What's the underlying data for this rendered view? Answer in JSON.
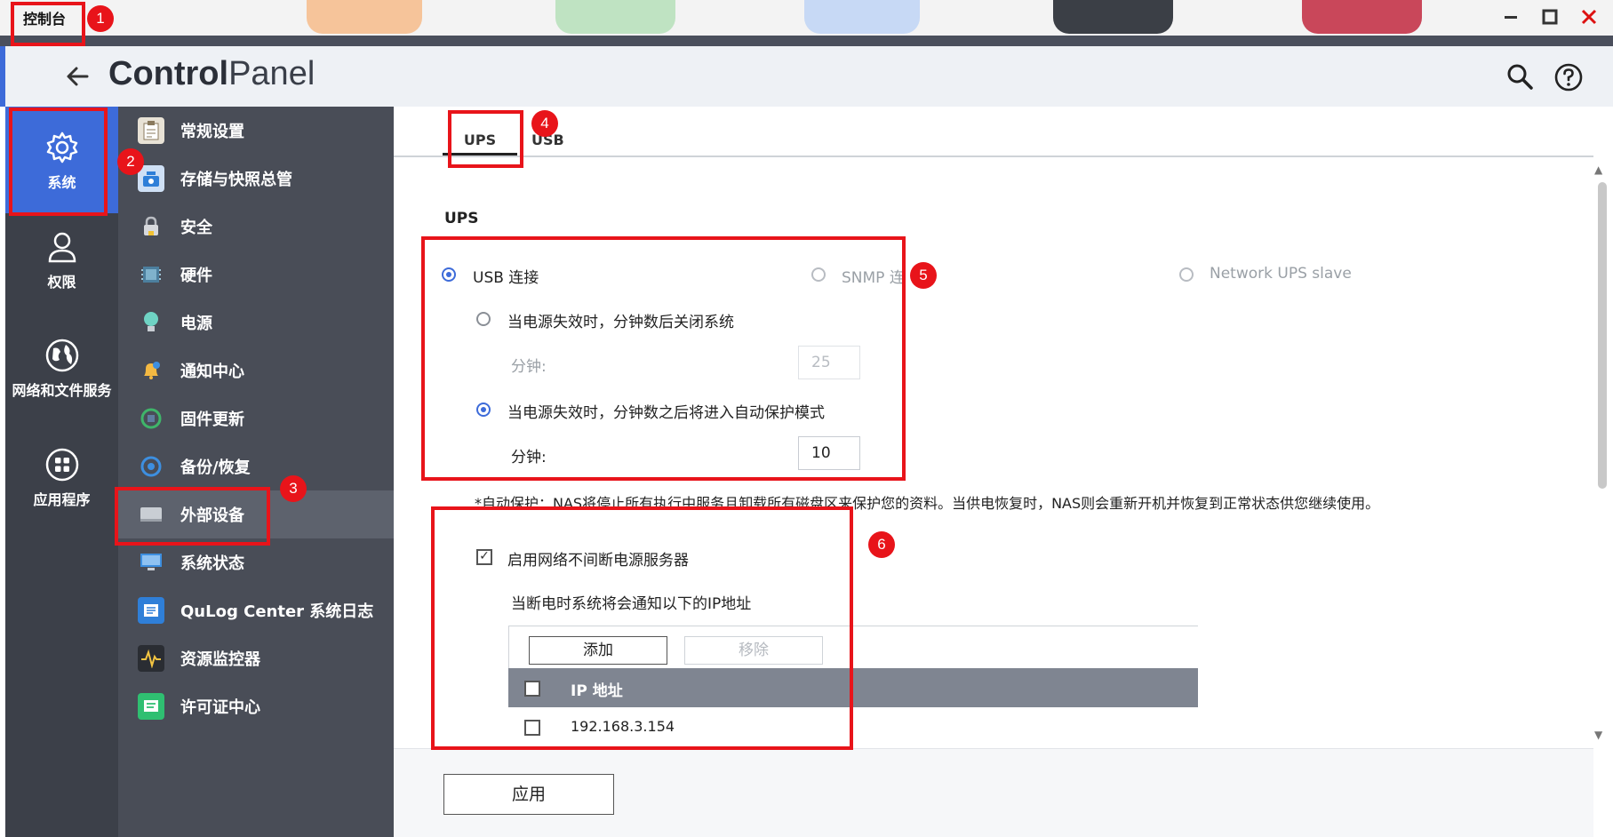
{
  "window": {
    "title": "控制台",
    "controls": [
      "minimize-icon",
      "maximize-icon",
      "close-icon"
    ]
  },
  "header": {
    "brand_bold": "Control",
    "brand_light": "Panel",
    "icons": [
      "back-arrow-icon",
      "search-icon",
      "help-icon"
    ]
  },
  "rail": {
    "items": [
      {
        "label": "系统",
        "icon": "gear-icon"
      },
      {
        "label": "权限",
        "icon": "user-icon"
      },
      {
        "label": "网络和文件服务",
        "icon": "globe-icon"
      },
      {
        "label": "应用程序",
        "icon": "apps-grid-icon"
      }
    ]
  },
  "menu": {
    "items": [
      {
        "label": "常规设置",
        "icon": "general-settings-icon"
      },
      {
        "label": "存储与快照总管",
        "icon": "storage-icon"
      },
      {
        "label": "安全",
        "icon": "lock-icon"
      },
      {
        "label": "硬件",
        "icon": "hardware-icon"
      },
      {
        "label": "电源",
        "icon": "power-bulb-icon"
      },
      {
        "label": "通知中心",
        "icon": "notification-icon"
      },
      {
        "label": "固件更新",
        "icon": "firmware-icon"
      },
      {
        "label": "备份/恢复",
        "icon": "backup-icon"
      },
      {
        "label": "外部设备",
        "icon": "external-device-icon"
      },
      {
        "label": "系统状态",
        "icon": "monitor-icon"
      },
      {
        "label": "QuLog Center 系统日志",
        "icon": "qulog-icon"
      },
      {
        "label": "资源监控器",
        "icon": "resource-monitor-icon"
      },
      {
        "label": "许可证中心",
        "icon": "license-icon"
      }
    ],
    "active": "外部设备"
  },
  "tabs": {
    "ups": "UPS",
    "usb": "USB",
    "active": "UPS"
  },
  "ups": {
    "section_title": "UPS",
    "mode_usb": "USB 连接",
    "mode_snmp": "SNMP 连",
    "mode_nut": "Network UPS slave",
    "opt_shutdown": "当电源失效时，分钟数后关闭系统",
    "minutes_label_1": "分钟:",
    "minutes_value_1": "25",
    "opt_protect": "当电源失效时，分钟数之后将进入自动保护模式",
    "minutes_label_2": "分钟:",
    "minutes_value_2": "10",
    "note": "*自动保护：NAS将停止所有执行中服务且卸载所有磁盘区来保护您的资料。当供电恢复时，NAS则会重新开机并恢复到正常状态供您继续使用。",
    "enable_server": "启用网络不间断电源服务器",
    "notify_text": "当断电时系统将会通知以下的IP地址",
    "add_btn": "添加",
    "remove_btn": "移除",
    "table_header": "IP 地址",
    "rows": [
      {
        "ip": "192.168.3.154"
      }
    ],
    "apply_btn": "应用"
  },
  "annotations": [
    "1",
    "2",
    "3",
    "4",
    "5",
    "6"
  ],
  "colors": {
    "accent": "#3d6bd9",
    "annotation_red": "#e8141a",
    "rail_bg": "#3c4049",
    "menu_bg": "#494d57"
  }
}
